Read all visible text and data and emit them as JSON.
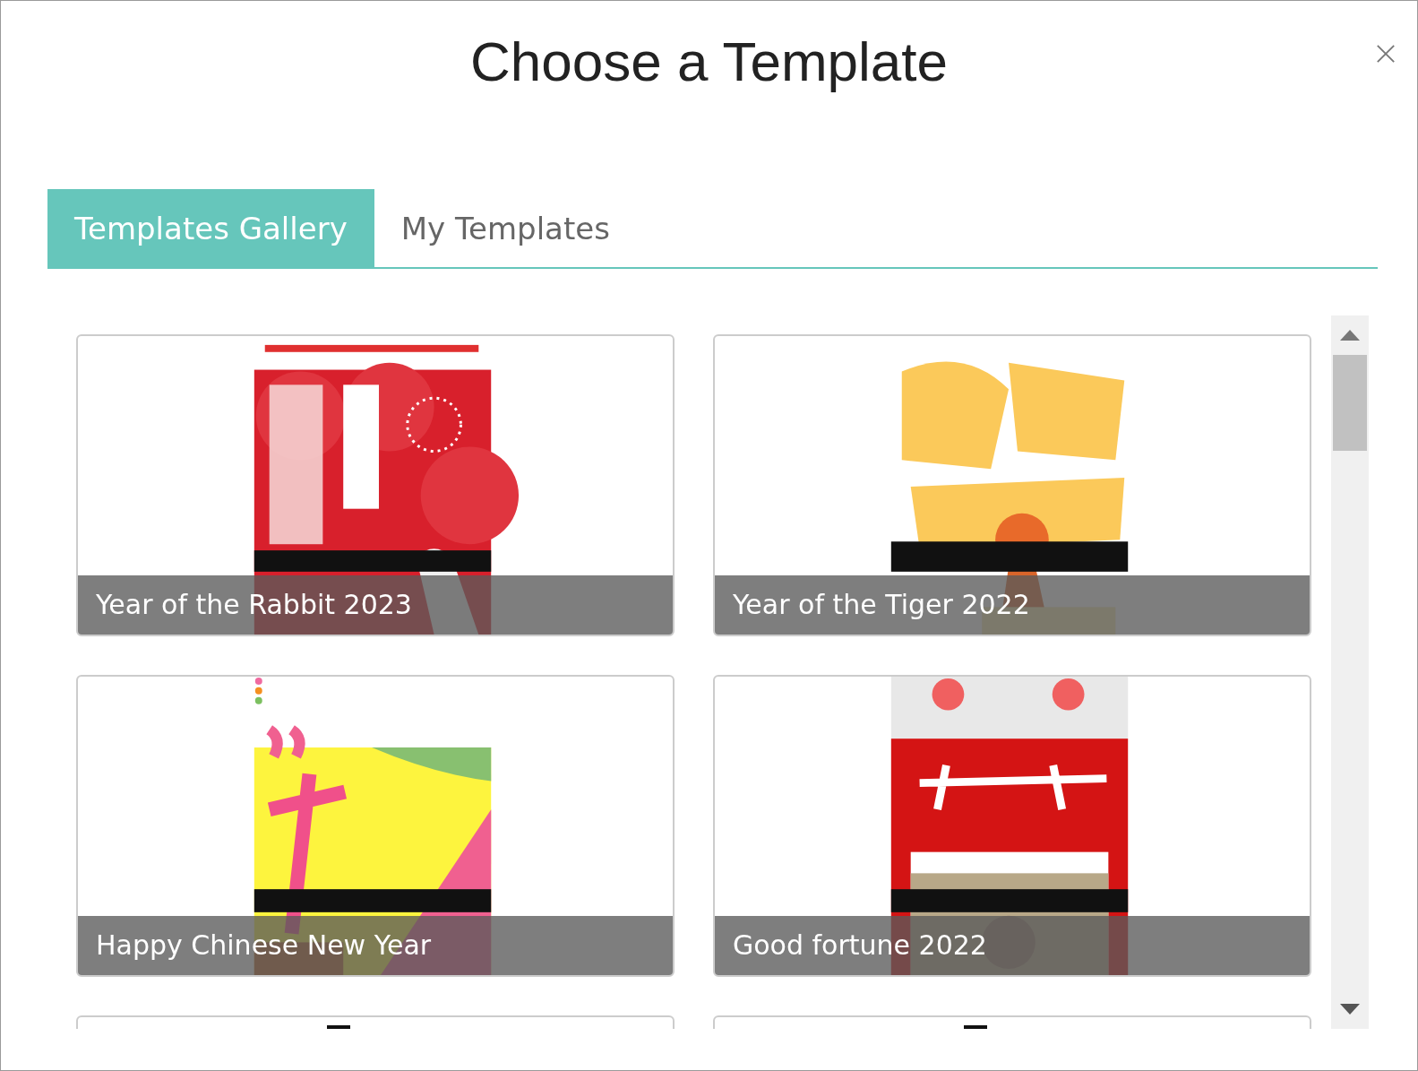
{
  "dialog": {
    "title": "Choose a Template"
  },
  "tabs": [
    {
      "label": "Templates Gallery",
      "selected": true
    },
    {
      "label": "My Templates",
      "selected": false
    }
  ],
  "templates": [
    {
      "title": "Year of the Rabbit 2023",
      "kind": "picture"
    },
    {
      "title": "Year of the Tiger 2022",
      "kind": "picture"
    },
    {
      "title": "Happy Chinese New Year",
      "kind": "picture"
    },
    {
      "title": "Good fortune 2022",
      "kind": "picture"
    },
    {
      "kind": "picture"
    },
    {
      "kind": "picture"
    }
  ]
}
